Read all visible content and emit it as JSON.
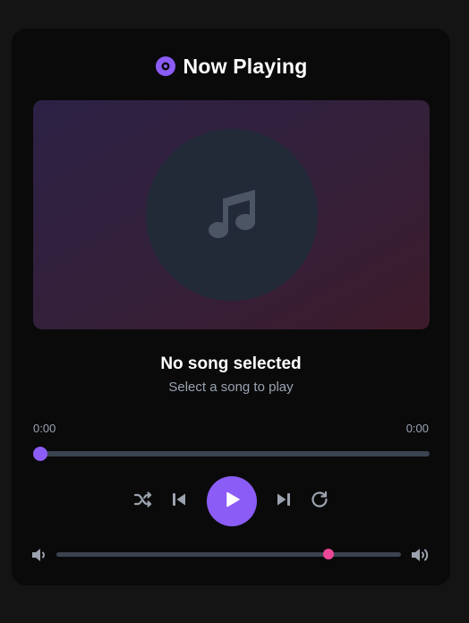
{
  "header": {
    "title": "Now Playing",
    "icon": "disc-icon"
  },
  "artwork": {
    "icon": "music-note-icon"
  },
  "song": {
    "title": "No song selected",
    "subtitle": "Select a song to play"
  },
  "progress": {
    "current_time": "0:00",
    "total_time": "0:00",
    "fraction": 0
  },
  "controls": {
    "icons": [
      "shuffle-icon",
      "previous-icon",
      "play-icon",
      "next-icon",
      "repeat-icon"
    ]
  },
  "volume": {
    "level": 0.79,
    "icons": [
      "volume-low-icon",
      "volume-high-icon"
    ]
  },
  "colors": {
    "accent": "#8b5cf6",
    "volume_accent": "#ec4899",
    "track": "#3b4351",
    "card_background": "#0a0a0a",
    "page_background": "#141414",
    "muted_text": "#9aa3b2"
  }
}
